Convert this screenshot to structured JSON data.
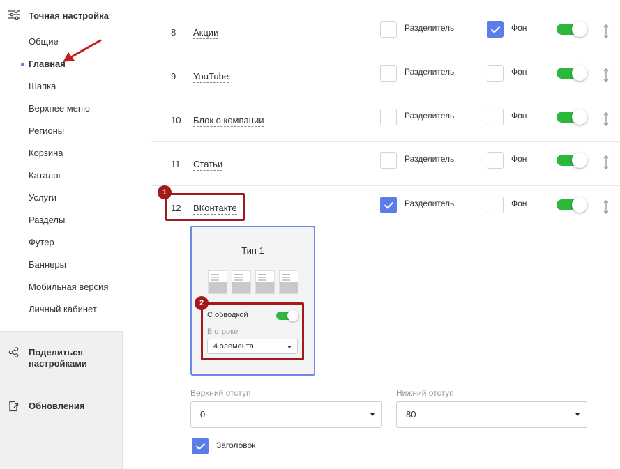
{
  "sidebar": {
    "header": "Точная настройка",
    "items": [
      {
        "label": "Общие",
        "active": false
      },
      {
        "label": "Главная",
        "active": true
      },
      {
        "label": "Шапка",
        "active": false
      },
      {
        "label": "Верхнее меню",
        "active": false
      },
      {
        "label": "Регионы",
        "active": false
      },
      {
        "label": "Корзина",
        "active": false
      },
      {
        "label": "Каталог",
        "active": false
      },
      {
        "label": "Услуги",
        "active": false
      },
      {
        "label": "Разделы",
        "active": false
      },
      {
        "label": "Футер",
        "active": false
      },
      {
        "label": "Баннеры",
        "active": false
      },
      {
        "label": "Мобильная версия",
        "active": false
      },
      {
        "label": "Личный кабинет",
        "active": false
      }
    ],
    "share_label": "Поделиться настройками",
    "updates_label": "Обновления"
  },
  "rows": [
    {
      "num": "8",
      "name": "Акции",
      "divider_label": "Разделитель",
      "divider_checked": false,
      "bg_label": "Фон",
      "bg_checked": true,
      "enabled": true
    },
    {
      "num": "9",
      "name": "YouTube",
      "divider_label": "Разделитель",
      "divider_checked": false,
      "bg_label": "Фон",
      "bg_checked": false,
      "enabled": true
    },
    {
      "num": "10",
      "name": "Блок о компании",
      "divider_label": "Разделитель",
      "divider_checked": false,
      "bg_label": "Фон",
      "bg_checked": false,
      "enabled": true
    },
    {
      "num": "11",
      "name": "Статьи",
      "divider_label": "Разделитель",
      "divider_checked": false,
      "bg_label": "Фон",
      "bg_checked": false,
      "enabled": true
    },
    {
      "num": "12",
      "name": "ВКонтакте",
      "divider_label": "Разделитель",
      "divider_checked": true,
      "bg_label": "Фон",
      "bg_checked": false,
      "enabled": true
    }
  ],
  "annotations": {
    "badge1": "1",
    "badge2": "2"
  },
  "type_card": {
    "title": "Тип 1",
    "outline_label": "С обводкой",
    "per_row_label": "В строке",
    "per_row_value": "4 элемента"
  },
  "top_padding": {
    "label": "Верхний отступ",
    "value": "0"
  },
  "bottom_padding": {
    "label": "Нижний отступ",
    "value": "80"
  },
  "header_checkbox": {
    "label": "Заголовок",
    "checked": true
  },
  "colors": {
    "accent": "#5b7de8",
    "toggle_on": "#2db83d",
    "annotation": "#a31a1a"
  }
}
